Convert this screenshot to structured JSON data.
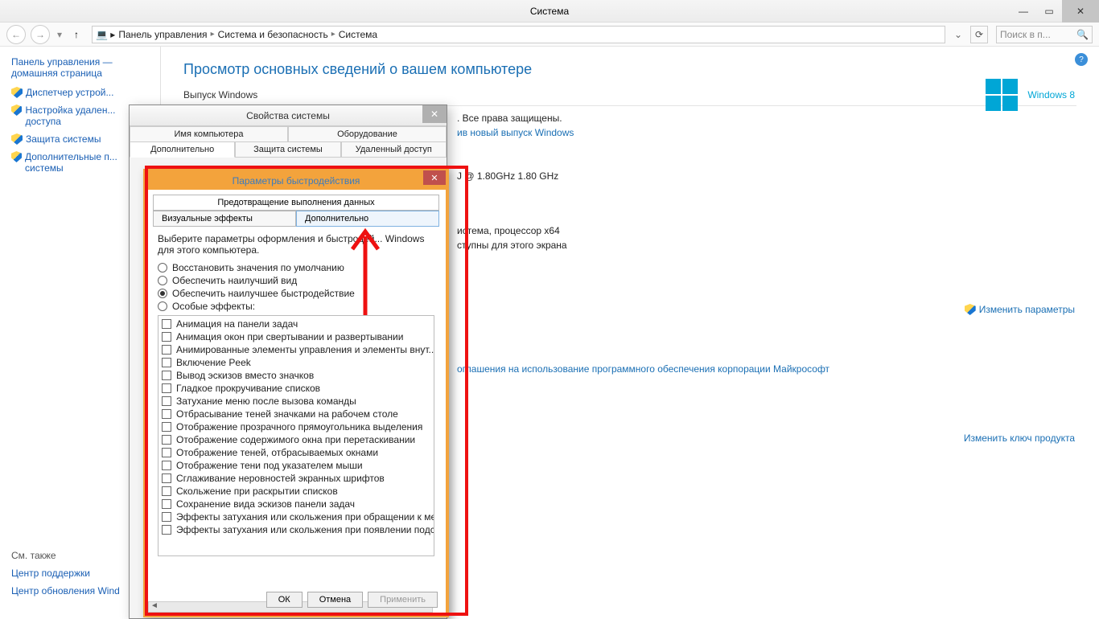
{
  "window": {
    "title": "Система"
  },
  "breadcrumb": {
    "root": "Панель управления",
    "mid": "Система и безопасность",
    "leaf": "Система"
  },
  "search": {
    "placeholder": "Поиск в п..."
  },
  "sidebar": {
    "home": "Панель управления — домашняя страница",
    "items": {
      "devmgr": "Диспетчер устрой...",
      "remote": "Настройка удален... доступа",
      "protect": "Защита системы",
      "advanced": "Дополнительные п... системы"
    },
    "see_also": {
      "title": "См. также",
      "support": "Центр поддержки",
      "update": "Центр обновления Wind"
    }
  },
  "main": {
    "heading": "Просмотр основных сведений о вашем компьютере",
    "edition_title": "Выпуск Windows",
    "rights": ". Все права защищены.",
    "upgrade": "ив новый выпуск Windows",
    "cpu_line": "J @ 1.80GHz  1.80 GHz",
    "sys_type": "истема, процессор x64",
    "touch": "ступны для этого экрана",
    "change_params": "Изменить параметры",
    "license_line": "оглашения на использование программного обеспечения корпорации Майкрософт",
    "prodkey": "Изменить ключ продукта",
    "brand": "Windows 8"
  },
  "dialog": {
    "title": "Свойства системы",
    "tabs": {
      "name": "Имя компьютера",
      "hw": "Оборудование",
      "adv": "Дополнительно",
      "protect": "Защита системы",
      "remote": "Удаленный доступ"
    }
  },
  "perf": {
    "title": "Параметры быстродействия",
    "top_tab": "Предотвращение выполнения данных",
    "tab_visual": "Визуальные эффекты",
    "tab_adv": "Дополнительно",
    "desc": "Выберите параметры оформления и быстродей... Windows для этого компьютера.",
    "radios": {
      "r1": "Восстановить значения по умолчанию",
      "r2": "Обеспечить наилучший вид",
      "r3": "Обеспечить наилучшее быстродействие",
      "r4": "Особые эффекты:"
    },
    "checks": [
      "Анимация на панели задач",
      "Анимация окон при свертывании и развертывании",
      "Анимированные элементы управления и элементы внут...",
      "Включение Peek",
      "Вывод эскизов вместо значков",
      "Гладкое прокручивание списков",
      "Затухание меню после вызова команды",
      "Отбрасывание теней значками на рабочем столе",
      "Отображение прозрачного прямоугольника выделения",
      "Отображение содержимого окна при перетаскивании",
      "Отображение теней, отбрасываемых окнами",
      "Отображение тени под указателем мыши",
      "Сглаживание неровностей экранных шрифтов",
      "Скольжение при раскрытии списков",
      "Сохранение вида эскизов панели задач",
      "Эффекты затухания или скольжения при обращении к ме",
      "Эффекты затухания или скольжения при появлении подс"
    ],
    "buttons": {
      "ok": "ОК",
      "cancel": "Отмена",
      "apply": "Применить"
    }
  }
}
